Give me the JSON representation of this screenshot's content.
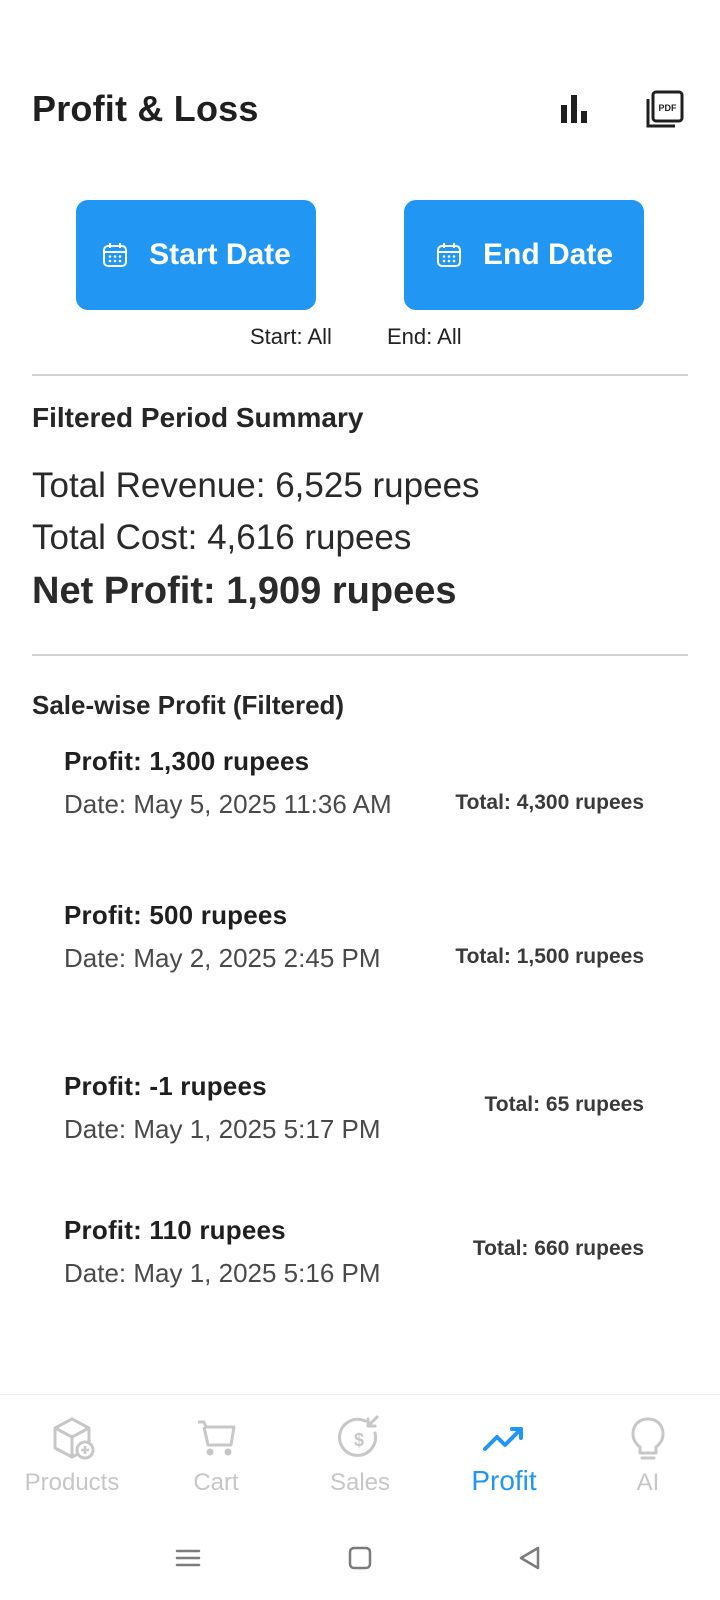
{
  "header": {
    "title": "Profit & Loss",
    "icons": {
      "chart": "bar-chart-icon",
      "pdf": "pdf-icon"
    }
  },
  "date_filters": {
    "start_label": "Start Date",
    "end_label": "End Date",
    "start_text": "Start: All",
    "end_text": "End: All"
  },
  "summary": {
    "title": "Filtered Period Summary",
    "total_revenue": "Total Revenue: 6,525 rupees",
    "total_cost": "Total Cost: 4,616 rupees",
    "net_profit": "Net Profit: 1,909 rupees"
  },
  "sales": {
    "title": "Sale-wise Profit (Filtered)",
    "items": [
      {
        "profit": "Profit: 1,300 rupees",
        "date": "Date: May 5, 2025 11:36 AM",
        "total": "Total: 4,300 rupees"
      },
      {
        "profit": "Profit: 500 rupees",
        "date": "Date: May 2, 2025 2:45 PM",
        "total": "Total: 1,500 rupees"
      },
      {
        "profit": "Profit: -1 rupees",
        "date": "Date: May 1, 2025 5:17 PM",
        "total": "Total: 65 rupees"
      },
      {
        "profit": "Profit: 110 rupees",
        "date": "Date: May 1, 2025 5:16 PM",
        "total": "Total: 660 rupees"
      }
    ]
  },
  "bottom_nav": {
    "items": [
      {
        "label": "Products",
        "icon": "products-icon",
        "active": false
      },
      {
        "label": "Cart",
        "icon": "cart-icon",
        "active": false
      },
      {
        "label": "Sales",
        "icon": "sales-icon",
        "active": false
      },
      {
        "label": "Profit",
        "icon": "trending-up-icon",
        "active": true
      },
      {
        "label": "AI",
        "icon": "lightbulb-icon",
        "active": false
      }
    ]
  },
  "colors": {
    "accent": "#2196f3",
    "inactive": "#c7c7c7",
    "text": "#1f1f1f"
  }
}
